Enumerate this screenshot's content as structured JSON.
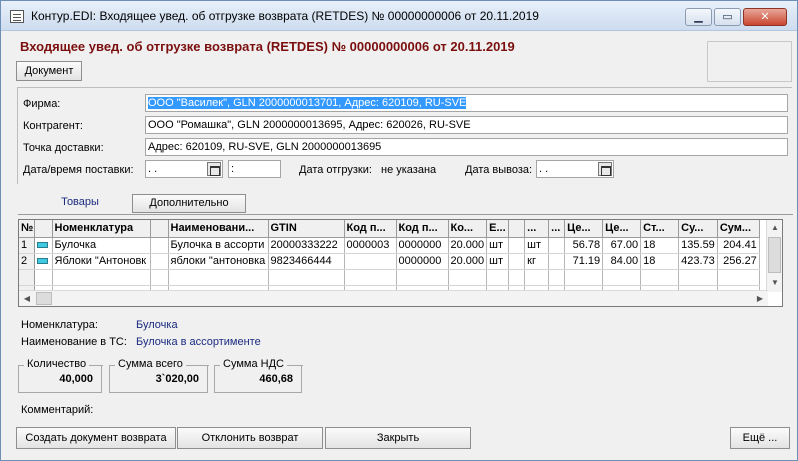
{
  "window": {
    "title": "Контур.EDI: Входящее увед. об отгрузке возврата (RETDES) № 00000000006 от 20.11.2019",
    "minimize": "▁",
    "maximize": "▭",
    "close": "✕"
  },
  "doc_title": "Входящее увед. об отгрузке возврата (RETDES) № 00000000006 от 20.11.2019",
  "toolbar": {
    "document_button": "Документ"
  },
  "form": {
    "firm_label": "Фирма:",
    "firm_value": "ООО \"Василек\", GLN 2000000013701, Адрес: 620109, RU-SVE",
    "counterparty_label": "Контрагент:",
    "counterparty_value": "ООО \"Ромашка\", GLN 2000000013695, Адрес: 620026, RU-SVE",
    "delivery_point_label": "Точка доставки:",
    "delivery_point_value": "Адрес: 620109, RU-SVE, GLN 2000000013695",
    "delivery_datetime_label": "Дата/время поставки:",
    "delivery_date_value": " .  .",
    "delivery_time_value": ":",
    "shipment_date_label": "Дата отгрузки:",
    "shipment_date_value": "не указана",
    "pickup_date_label": "Дата вывоза:",
    "pickup_date_value": " .  ."
  },
  "tabs": [
    {
      "label": "Товары",
      "active": true
    },
    {
      "label": "Дополнительно",
      "active": false
    }
  ],
  "grid": {
    "headers": [
      "№",
      "",
      "Номенклатура",
      "",
      "Наименовани...",
      "GTIN",
      "Код п...",
      "Код п...",
      "Ко...",
      "Е...",
      "",
      "...",
      "...",
      "Це...",
      "Це...",
      "Ст...",
      "Су...",
      "Сум..."
    ],
    "rows": [
      [
        "1",
        "",
        "Булочка",
        "",
        "Булочка в ассорти",
        "20000333222",
        "0000003",
        "0000000",
        "20.000",
        "шт",
        "",
        "шт",
        "",
        "56.78",
        "67.00",
        "18",
        "135.59",
        "204.41"
      ],
      [
        "2",
        "",
        "Яблоки \"Антоновк",
        "",
        "яблоки \"антоновка",
        "9823466444",
        "",
        "0000000",
        "20.000",
        "шт",
        "",
        "кг",
        "",
        "71.19",
        "84.00",
        "18",
        "423.73",
        "256.27"
      ]
    ]
  },
  "info": {
    "nomenclature_label": "Номенклатура:",
    "nomenclature_value": "Булочка",
    "tc_name_label": "Наименование в ТС:",
    "tc_name_value": "Булочка в ассортименте"
  },
  "totals": {
    "quantity_label": "Количество",
    "quantity_value": "40,000",
    "sum_total_label": "Сумма всего",
    "sum_total_value": "3`020,00",
    "vat_label": "Сумма НДС",
    "vat_value": "460,68"
  },
  "comment_label": "Комментарий:",
  "buttons": {
    "create_return": "Создать документ возврата",
    "reject_return": "Отклонить возврат",
    "close": "Закрыть",
    "more": "Ещё ..."
  },
  "colors": {
    "doc_title": "#7b0f0f",
    "selection": "#3399ff",
    "info_text": "#1b2a80"
  }
}
